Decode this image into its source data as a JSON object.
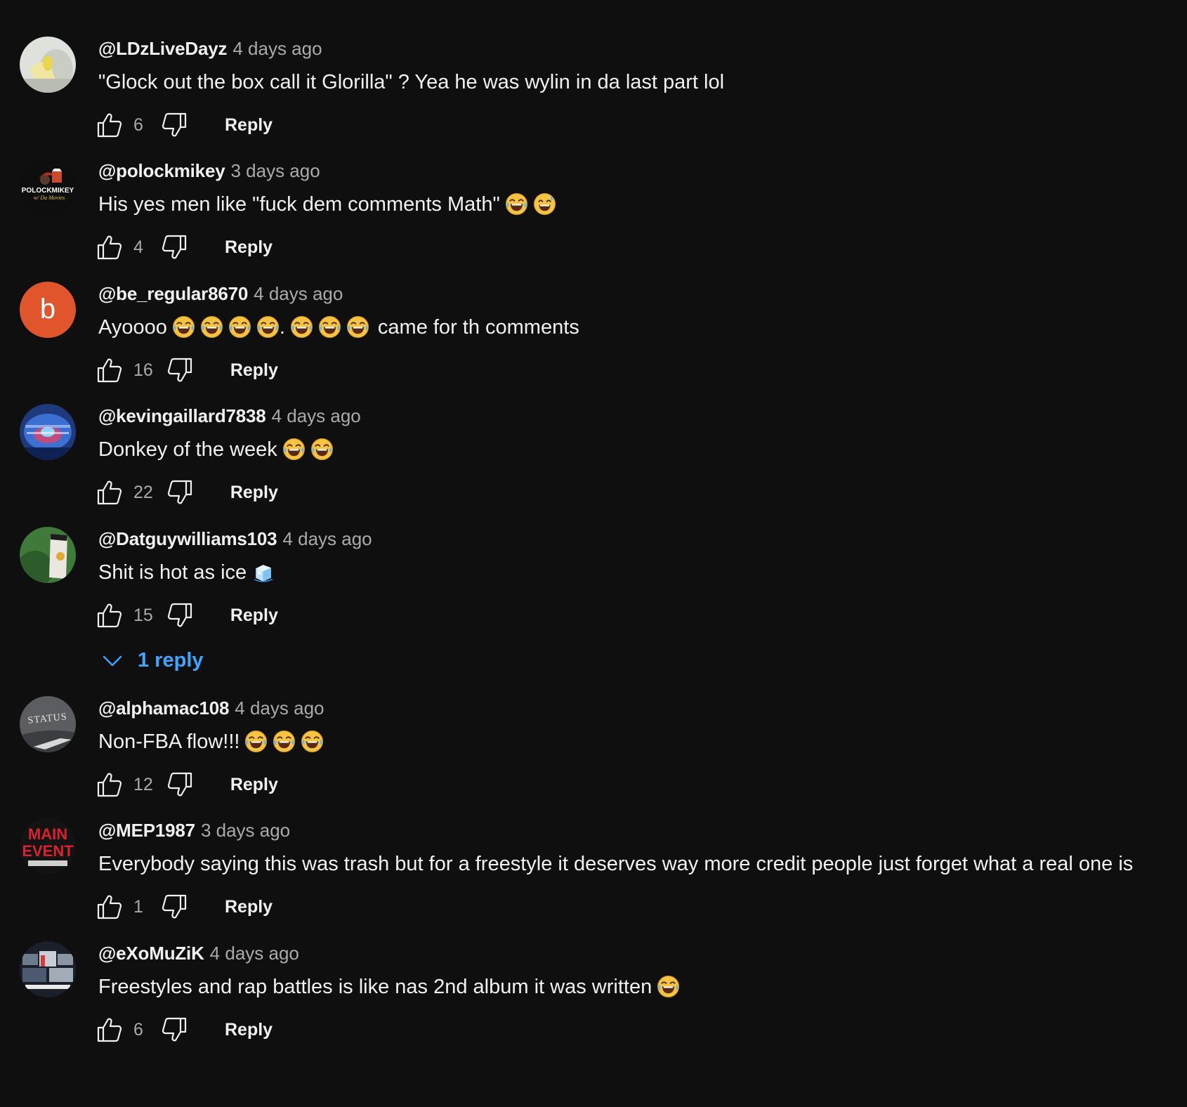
{
  "comments": [
    {
      "author": "@LDzLiveDayz",
      "time": "4 days ago",
      "text": "\"Glock out the box call it Glorilla\" ? Yea he was wylin in da last part lol",
      "likes": "6",
      "reply_label": "Reply",
      "avatar": "photo-avatar-light",
      "emojis": []
    },
    {
      "author": "@polockmikey",
      "time": "3 days ago",
      "text": "His yes men like \"fuck dem comments Math\"",
      "likes": "4",
      "reply_label": "Reply",
      "avatar": "logo-avatar-polockmikey",
      "avatar_text": [
        "POLOCKMIKEY",
        "w/ Da Movies"
      ],
      "emojis": [
        "tears-of-joy",
        "grinning-sweat"
      ]
    },
    {
      "author": "@be_regular8670",
      "time": "4 days ago",
      "text_before": "Ayoooo",
      "text_mid": ".",
      "text_after": "came for th comments",
      "likes": "16",
      "reply_label": "Reply",
      "avatar": "letter-avatar",
      "avatar_letter": "b",
      "avatar_color": "#e0552b",
      "emojis": [
        "tears-of-joy",
        "tears-of-joy",
        "tears-of-joy",
        "tears-of-joy",
        "tears-of-joy",
        "tears-of-joy",
        "tears-of-joy"
      ]
    },
    {
      "author": "@kevingaillard7838",
      "time": "4 days ago",
      "text": "Donkey of the week",
      "likes": "22",
      "reply_label": "Reply",
      "avatar": "logo-avatar-blue",
      "emojis": [
        "tears-of-joy",
        "tears-of-joy"
      ]
    },
    {
      "author": "@Datguywilliams103",
      "time": "4 days ago",
      "text": "Shit is hot as ice",
      "likes": "15",
      "reply_label": "Reply",
      "avatar": "photo-avatar-green",
      "emojis": [
        "ice-cube"
      ],
      "replies_label": "1 reply"
    },
    {
      "author": "@alphamac108",
      "time": "4 days ago",
      "text": "Non-FBA flow!!!",
      "likes": "12",
      "reply_label": "Reply",
      "avatar": "logo-avatar-status",
      "avatar_text": [
        "STATUS"
      ],
      "emojis": [
        "tears-of-joy",
        "tears-of-joy",
        "tears-of-joy"
      ]
    },
    {
      "author": "@MEP1987",
      "time": "3 days ago",
      "text": "Everybody saying this was trash but for a freestyle it deserves way more credit people just forget what a real one is",
      "likes": "1",
      "reply_label": "Reply",
      "avatar": "logo-avatar-main-event",
      "avatar_text": [
        "MAIN",
        "EVENT"
      ],
      "emojis": []
    },
    {
      "author": "@eXoMuZiK",
      "time": "4 days ago",
      "text": "Freestyles and rap battles is like nas 2nd album it was written",
      "likes": "6",
      "reply_label": "Reply",
      "avatar": "photo-avatar-collage",
      "emojis": [
        "tears-of-joy"
      ]
    }
  ],
  "colors": {
    "background": "#0f0f0f",
    "text_primary": "#f1f1f1",
    "text_secondary": "#aaaaaa",
    "link_blue": "#3ea6ff"
  },
  "icons": {
    "like": "thumbs-up-icon",
    "dislike": "thumbs-down-icon",
    "expand_replies": "chevron-down-icon"
  }
}
